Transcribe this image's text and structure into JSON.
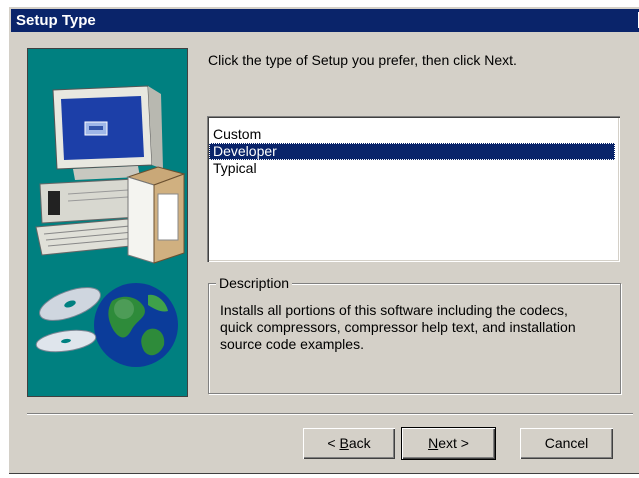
{
  "window": {
    "title": "Setup Type",
    "close_glyph": "×"
  },
  "prompt": "Click the type of Setup you prefer, then click Next.",
  "setup_types": {
    "items": [
      "Custom",
      "Developer",
      "Typical"
    ],
    "selected": "Developer"
  },
  "description": {
    "legend": "Description",
    "text": "Installs all portions of this software including the codecs, quick compressors, compressor help text, and installation source code examples."
  },
  "buttons": {
    "back_prefix": "< ",
    "back_key": "B",
    "back_rest": "ack",
    "next_key": "N",
    "next_rest": "ext >",
    "cancel": "Cancel"
  },
  "colors": {
    "title_bar": "#0a246a",
    "art_panel": "#008080",
    "selection": "#0a246a",
    "dialog_face": "#d4d0c8"
  },
  "icons": {
    "art": "computer-and-globe-illustration",
    "close": "close-icon"
  }
}
